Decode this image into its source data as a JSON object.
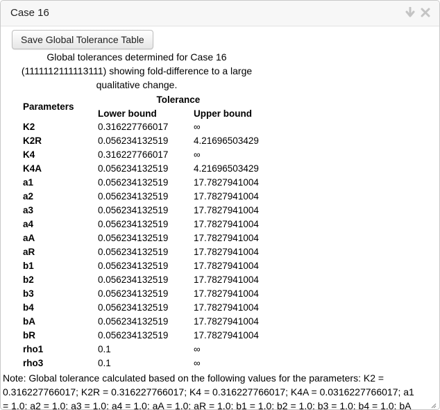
{
  "window": {
    "title": "Case 16"
  },
  "toolbar": {
    "save_label": "Save Global Tolerance Table"
  },
  "caption": "Global tolerances determined for Case 16 (1111112111113111) showing fold-difference to a large qualitative change.",
  "table": {
    "header_parameters": "Parameters",
    "header_tolerance": "Tolerance",
    "header_lower": "Lower bound",
    "header_upper": "Upper bound",
    "rows": [
      {
        "param": "K2",
        "lower": "0.316227766017",
        "upper": "∞"
      },
      {
        "param": "K2R",
        "lower": "0.056234132519",
        "upper": "4.21696503429"
      },
      {
        "param": "K4",
        "lower": "0.316227766017",
        "upper": "∞"
      },
      {
        "param": "K4A",
        "lower": "0.056234132519",
        "upper": "4.21696503429"
      },
      {
        "param": "a1",
        "lower": "0.056234132519",
        "upper": "17.7827941004"
      },
      {
        "param": "a2",
        "lower": "0.056234132519",
        "upper": "17.7827941004"
      },
      {
        "param": "a3",
        "lower": "0.056234132519",
        "upper": "17.7827941004"
      },
      {
        "param": "a4",
        "lower": "0.056234132519",
        "upper": "17.7827941004"
      },
      {
        "param": "aA",
        "lower": "0.056234132519",
        "upper": "17.7827941004"
      },
      {
        "param": "aR",
        "lower": "0.056234132519",
        "upper": "17.7827941004"
      },
      {
        "param": "b1",
        "lower": "0.056234132519",
        "upper": "17.7827941004"
      },
      {
        "param": "b2",
        "lower": "0.056234132519",
        "upper": "17.7827941004"
      },
      {
        "param": "b3",
        "lower": "0.056234132519",
        "upper": "17.7827941004"
      },
      {
        "param": "b4",
        "lower": "0.056234132519",
        "upper": "17.7827941004"
      },
      {
        "param": "bA",
        "lower": "0.056234132519",
        "upper": "17.7827941004"
      },
      {
        "param": "bR",
        "lower": "0.056234132519",
        "upper": "17.7827941004"
      },
      {
        "param": "rho1",
        "lower": "0.1",
        "upper": "∞"
      },
      {
        "param": "rho3",
        "lower": "0.1",
        "upper": "∞"
      }
    ]
  },
  "note": "Note: Global tolerance calculated based on the following values for the parameters: K2 = 0.316227766017; K2R = 0.316227766017; K4 = 0.316227766017; K4A = 0.0316227766017; a1 = 1.0; a2 = 1.0; a3 = 1.0; a4 = 1.0; aA = 1.0; aR = 1.0; b1 = 1.0; b2 = 1.0; b3 = 1.0; b4 = 1.0; bA",
  "icons": {
    "download": "download-arrow-icon",
    "close": "close-icon",
    "resize": "resize-grip-icon"
  }
}
